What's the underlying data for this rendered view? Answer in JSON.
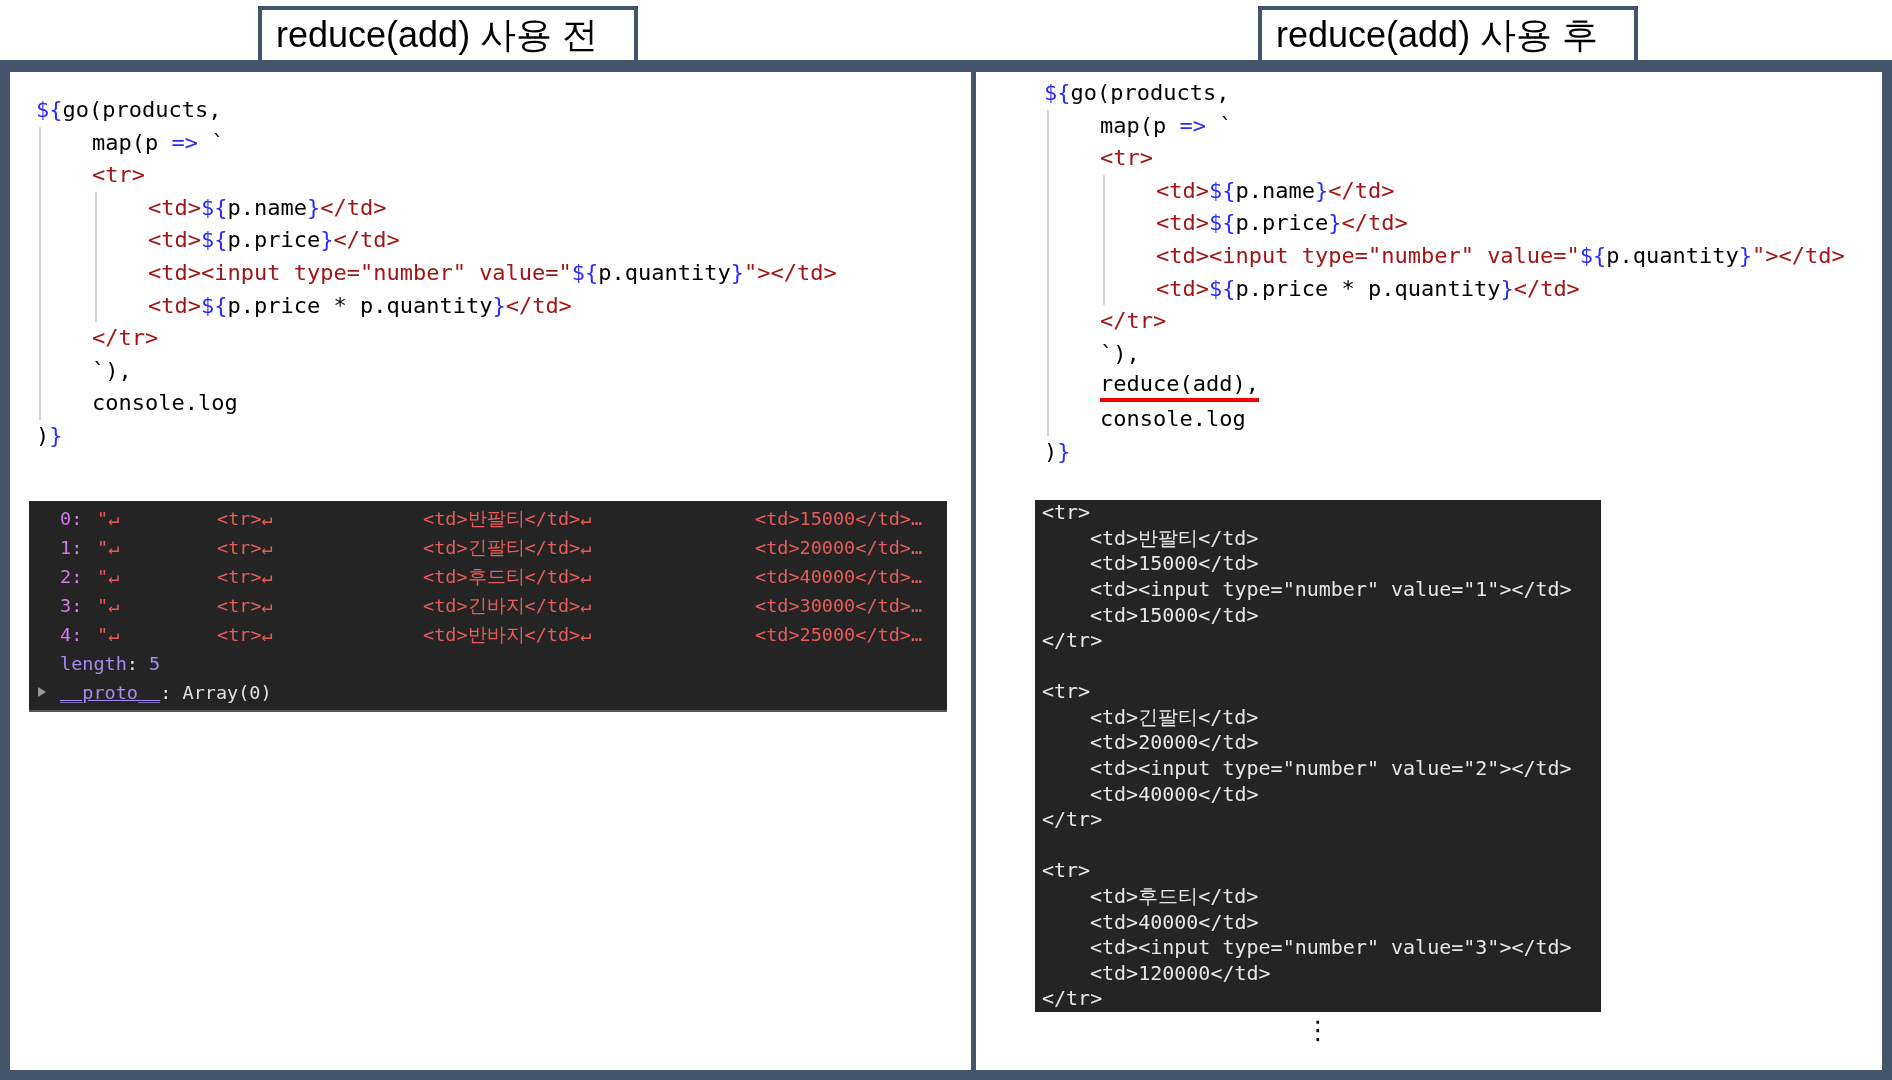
{
  "panels": [
    {
      "title": "reduce(add) 사용 전",
      "code": [
        {
          "underlined": false,
          "tokens": [
            {
              "kind": "accent",
              "text": "${"
            },
            {
              "kind": "plain",
              "text": "go(products,"
            }
          ],
          "children": [
            {
              "underlined": false,
              "tokens": [
                {
                  "kind": "plain",
                  "text": "map(p "
                },
                {
                  "kind": "accent",
                  "text": "=>"
                },
                {
                  "kind": "plain",
                  "text": " `"
                }
              ]
            },
            {
              "underlined": false,
              "tokens": [
                {
                  "kind": "markup",
                  "text": "<tr>"
                }
              ],
              "children": [
                {
                  "underlined": false,
                  "tokens": [
                    {
                      "kind": "markup",
                      "text": "<td>"
                    },
                    {
                      "kind": "accent",
                      "text": "${"
                    },
                    {
                      "kind": "plain",
                      "text": "p.name"
                    },
                    {
                      "kind": "accent",
                      "text": "}"
                    },
                    {
                      "kind": "markup",
                      "text": "</td>"
                    }
                  ]
                },
                {
                  "underlined": false,
                  "tokens": [
                    {
                      "kind": "markup",
                      "text": "<td>"
                    },
                    {
                      "kind": "accent",
                      "text": "${"
                    },
                    {
                      "kind": "plain",
                      "text": "p.price"
                    },
                    {
                      "kind": "accent",
                      "text": "}"
                    },
                    {
                      "kind": "markup",
                      "text": "</td>"
                    }
                  ]
                },
                {
                  "underlined": false,
                  "tokens": [
                    {
                      "kind": "markup",
                      "text": "<td><input type=\"number\" value=\""
                    },
                    {
                      "kind": "accent",
                      "text": "${"
                    },
                    {
                      "kind": "plain",
                      "text": "p.quantity"
                    },
                    {
                      "kind": "accent",
                      "text": "}"
                    },
                    {
                      "kind": "markup",
                      "text": "\"></td>"
                    }
                  ]
                },
                {
                  "underlined": false,
                  "tokens": [
                    {
                      "kind": "markup",
                      "text": "<td>"
                    },
                    {
                      "kind": "accent",
                      "text": "${"
                    },
                    {
                      "kind": "plain",
                      "text": "p.price * p.quantity"
                    },
                    {
                      "kind": "accent",
                      "text": "}"
                    },
                    {
                      "kind": "markup",
                      "text": "</td>"
                    }
                  ]
                }
              ]
            },
            {
              "underlined": false,
              "tokens": [
                {
                  "kind": "markup",
                  "text": "</tr>"
                }
              ]
            },
            {
              "underlined": false,
              "tokens": [
                {
                  "kind": "plain",
                  "text": "`),"
                }
              ]
            },
            {
              "underlined": false,
              "tokens": [
                {
                  "kind": "plain",
                  "text": "console.log"
                }
              ]
            }
          ]
        },
        {
          "underlined": false,
          "tokens": [
            {
              "kind": "plain",
              "text": ")"
            },
            {
              "kind": "accent",
              "text": "}"
            }
          ]
        }
      ],
      "console": {
        "kind": "array",
        "rows": [
          {
            "index": "0:",
            "parts": [
              "\"↵",
              "<tr>↵",
              "<td>반팔티</td>↵",
              "<td>15000</td>…"
            ]
          },
          {
            "index": "1:",
            "parts": [
              "\"↵",
              "<tr>↵",
              "<td>긴팔티</td>↵",
              "<td>20000</td>…"
            ]
          },
          {
            "index": "2:",
            "parts": [
              "\"↵",
              "<tr>↵",
              "<td>후드티</td>↵",
              "<td>40000</td>…"
            ]
          },
          {
            "index": "3:",
            "parts": [
              "\"↵",
              "<tr>↵",
              "<td>긴바지</td>↵",
              "<td>30000</td>…"
            ]
          },
          {
            "index": "4:",
            "parts": [
              "\"↵",
              "<tr>↵",
              "<td>반바지</td>↵",
              "<td>25000</td>…"
            ]
          }
        ],
        "length": {
          "key": "length",
          "colon": ": ",
          "value": "5"
        },
        "proto": {
          "key": "__proto__",
          "rest": ": Array(0)",
          "expanded": false
        }
      }
    },
    {
      "title": "reduce(add) 사용 후",
      "code": [
        {
          "underlined": false,
          "tokens": [
            {
              "kind": "accent",
              "text": "${"
            },
            {
              "kind": "plain",
              "text": "go(products,"
            }
          ],
          "children": [
            {
              "underlined": false,
              "tokens": [
                {
                  "kind": "plain",
                  "text": "map(p "
                },
                {
                  "kind": "accent",
                  "text": "=>"
                },
                {
                  "kind": "plain",
                  "text": " `"
                }
              ]
            },
            {
              "underlined": false,
              "tokens": [
                {
                  "kind": "markup",
                  "text": "<tr>"
                }
              ],
              "children": [
                {
                  "underlined": false,
                  "tokens": [
                    {
                      "kind": "markup",
                      "text": "<td>"
                    },
                    {
                      "kind": "accent",
                      "text": "${"
                    },
                    {
                      "kind": "plain",
                      "text": "p.name"
                    },
                    {
                      "kind": "accent",
                      "text": "}"
                    },
                    {
                      "kind": "markup",
                      "text": "</td>"
                    }
                  ]
                },
                {
                  "underlined": false,
                  "tokens": [
                    {
                      "kind": "markup",
                      "text": "<td>"
                    },
                    {
                      "kind": "accent",
                      "text": "${"
                    },
                    {
                      "kind": "plain",
                      "text": "p.price"
                    },
                    {
                      "kind": "accent",
                      "text": "}"
                    },
                    {
                      "kind": "markup",
                      "text": "</td>"
                    }
                  ]
                },
                {
                  "underlined": false,
                  "tokens": [
                    {
                      "kind": "markup",
                      "text": "<td><input type=\"number\" value=\""
                    },
                    {
                      "kind": "accent",
                      "text": "${"
                    },
                    {
                      "kind": "plain",
                      "text": "p.quantity"
                    },
                    {
                      "kind": "accent",
                      "text": "}"
                    },
                    {
                      "kind": "markup",
                      "text": "\"></td>"
                    }
                  ]
                },
                {
                  "underlined": false,
                  "tokens": [
                    {
                      "kind": "markup",
                      "text": "<td>"
                    },
                    {
                      "kind": "accent",
                      "text": "${"
                    },
                    {
                      "kind": "plain",
                      "text": "p.price * p.quantity"
                    },
                    {
                      "kind": "accent",
                      "text": "}"
                    },
                    {
                      "kind": "markup",
                      "text": "</td>"
                    }
                  ]
                }
              ]
            },
            {
              "underlined": false,
              "tokens": [
                {
                  "kind": "markup",
                  "text": "</tr>"
                }
              ]
            },
            {
              "underlined": false,
              "tokens": [
                {
                  "kind": "plain",
                  "text": "`),"
                }
              ]
            },
            {
              "underlined": true,
              "tokens": [
                {
                  "kind": "plain",
                  "text": "reduce(add),"
                }
              ]
            },
            {
              "underlined": false,
              "tokens": [
                {
                  "kind": "plain",
                  "text": "console.log"
                }
              ]
            }
          ]
        },
        {
          "underlined": false,
          "tokens": [
            {
              "kind": "plain",
              "text": ")"
            },
            {
              "kind": "accent",
              "text": "}"
            }
          ]
        }
      ],
      "console": {
        "kind": "string",
        "blocks": [
          {
            "open": "<tr>",
            "cells": [
              "<td>반팔티</td>",
              "<td>15000</td>",
              "<td><input type=\"number\" value=\"1\"></td>",
              "<td>15000</td>"
            ],
            "close": "</tr>"
          },
          {
            "open": "<tr>",
            "cells": [
              "<td>긴팔티</td>",
              "<td>20000</td>",
              "<td><input type=\"number\" value=\"2\"></td>",
              "<td>40000</td>"
            ],
            "close": "</tr>"
          },
          {
            "open": "<tr>",
            "cells": [
              "<td>후드티</td>",
              "<td>40000</td>",
              "<td><input type=\"number\" value=\"3\"></td>",
              "<td>120000</td>"
            ],
            "close": "</tr>"
          }
        ],
        "more": "⋮"
      }
    }
  ]
}
